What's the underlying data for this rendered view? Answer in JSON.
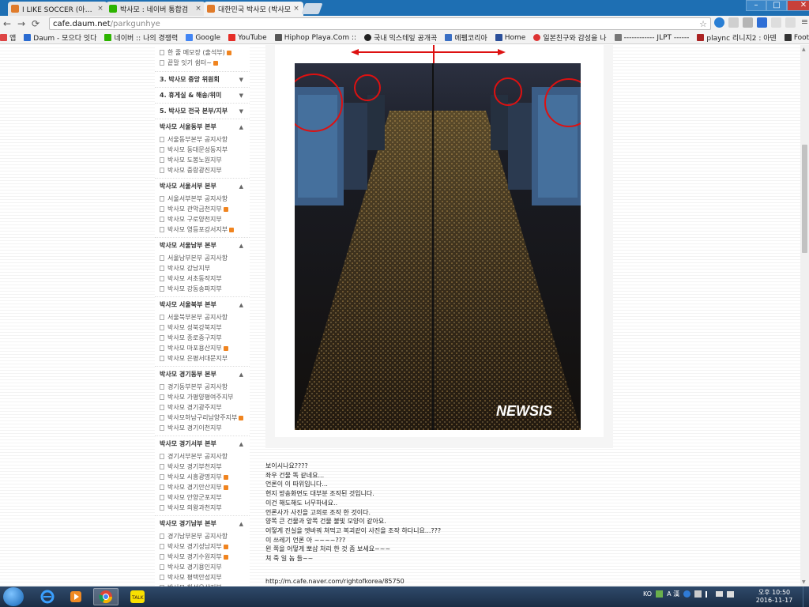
{
  "tabs": [
    {
      "label": "I LIKE SOCCER (아이라이",
      "fav_color": "#e07b2a"
    },
    {
      "label": "박사모 : 네이버 통합검",
      "fav_color": "#2db400"
    },
    {
      "label": "대한민국 박사모 (박사모",
      "fav_color": "#e07b2a"
    }
  ],
  "tab_close": "×",
  "window_controls": {
    "minimize": "–",
    "maximize": "□",
    "close": "✕"
  },
  "nav": {
    "back": "←",
    "forward": "→",
    "reload": "⟳"
  },
  "address": {
    "host": "cafe.daum.net",
    "path": "/parkgunhye",
    "star": "☆"
  },
  "bookmarks": [
    {
      "label": "앱",
      "color": "#d44"
    },
    {
      "label": "Daum - 모으다 잇다",
      "color": "#2a6bd1"
    },
    {
      "label": "네이버 :: 나의 경쟁력",
      "color": "#2db400"
    },
    {
      "label": "Google",
      "color": "#4285f4"
    },
    {
      "label": "YouTube",
      "color": "#e52d27"
    },
    {
      "label": "Hiphop Playa.Com ::",
      "color": "#555"
    },
    {
      "label": "국내 믹스테잎 공개곡",
      "color": "#222"
    },
    {
      "label": "에펨코리아",
      "color": "#3a6fc4"
    },
    {
      "label": "Home",
      "color": "#2a4f9a"
    },
    {
      "label": "일본친구와 감성을 나",
      "color": "#d33"
    },
    {
      "label": "------------ JLPT ------",
      "color": "#777"
    },
    {
      "label": "plaync 리니지2 : 아덴",
      "color": "#a22"
    },
    {
      "label": "Football Statistics | F",
      "color": "#333"
    }
  ],
  "sidebar": {
    "top_items": [
      {
        "label": "한 줄 메모장 (출석부)",
        "new": true
      },
      {
        "label": "끝말 잇기 쉼터~",
        "new": true
      }
    ],
    "collapsed_sections": [
      "3. 박사모 중앙 위원회",
      "4. 휴게실 & 해송/위미",
      "5. 박사모 전국 본부/지부"
    ],
    "sections": [
      {
        "title": "박사모 서울동부 본부",
        "items": [
          {
            "label": "서울동부본부 공지사항",
            "new": false
          },
          {
            "label": "박사모 동대문성동지부",
            "new": false
          },
          {
            "label": "박사모 도봉노원지부",
            "new": false
          },
          {
            "label": "박사모 중랑광진지부",
            "new": false
          }
        ]
      },
      {
        "title": "박사모 서울서부 본부",
        "items": [
          {
            "label": "서울서부본부 공지사항",
            "new": false
          },
          {
            "label": "박사모 관악금천지부",
            "new": true
          },
          {
            "label": "박사모 구로양천지부",
            "new": false
          },
          {
            "label": "박사모 영등포강서지부",
            "new": true
          }
        ]
      },
      {
        "title": "박사모 서울남부 본부",
        "items": [
          {
            "label": "서울남부본부 공지사항",
            "new": false
          },
          {
            "label": "박사모 강남지부",
            "new": false
          },
          {
            "label": "박사모 서초동작지부",
            "new": false
          },
          {
            "label": "박사모 강동송파지부",
            "new": false
          }
        ]
      },
      {
        "title": "박사모 서울북부 본부",
        "items": [
          {
            "label": "서울북부본부 공지사항",
            "new": false
          },
          {
            "label": "박사모 성북강북지부",
            "new": false
          },
          {
            "label": "박사모 종로중구지부",
            "new": false
          },
          {
            "label": "박사모 마포용산지부",
            "new": true
          },
          {
            "label": "박사모 은평서대문지부",
            "new": false
          }
        ]
      },
      {
        "title": "박사모 경기동부 본부",
        "items": [
          {
            "label": "경기동부본부 공지사항",
            "new": false
          },
          {
            "label": "박사모 가평양평여주지부",
            "new": false
          },
          {
            "label": "박사모 경기광주지부",
            "new": false
          },
          {
            "label": "박사모하남구리남양주지부",
            "new": true
          },
          {
            "label": "박사모 경기이천지부",
            "new": false
          }
        ]
      },
      {
        "title": "박사모 경기서부 본부",
        "items": [
          {
            "label": "경기서부본부 공지사항",
            "new": false
          },
          {
            "label": "박사모 경기부천지부",
            "new": false
          },
          {
            "label": "박사모 시흥광명지부",
            "new": true
          },
          {
            "label": "박사모 경기안산지부",
            "new": true
          },
          {
            "label": "박사모 안양군포지부",
            "new": false
          },
          {
            "label": "박사모 의왕과천지부",
            "new": false
          }
        ]
      },
      {
        "title": "박사모 경기남부 본부",
        "items": [
          {
            "label": "경기남부본부 공지사항",
            "new": false
          },
          {
            "label": "박사모 경기성남지부",
            "new": true
          },
          {
            "label": "박사모 경기수원지부",
            "new": true
          },
          {
            "label": "박사모 경기용인지부",
            "new": false
          },
          {
            "label": "박사모 평택안성지부",
            "new": false
          },
          {
            "label": "박사모 화성오산지부",
            "new": false
          }
        ]
      }
    ]
  },
  "photo": {
    "watermark": "NEWSIS"
  },
  "post": {
    "lines": [
      "보이시나요????",
      "좌우 건물 똑 같네요...",
      "언론이 이 따위입니다...",
      "현지 방송화면도 대부분 조작된 것입니다.",
      "이건 해도해도 너무하네요..",
      "언론사가 사진을 고의로 조작 한 것이다.",
      "양쪽 큰 건물과 앞쪽 건물 불빛 모양이 같아요.",
      "어떻게 진실을 엣바꿔 쳐먹고 복괴같이 사진을 조작 하다니요...???",
      "이 쓰레기 언론 아 ~~~~???",
      "왼 쪽을 어떻게 뽀샵 처리 한 것 좀 보세요~~~",
      "쳐 죽 일 놈 들~~"
    ],
    "link": "http://m.cafe.naver.com/rightofkorea/85750"
  },
  "taskbar": {
    "lang": "KO",
    "ime": "A 漢",
    "time": "오후 10:50",
    "date": "2016-11-17"
  }
}
